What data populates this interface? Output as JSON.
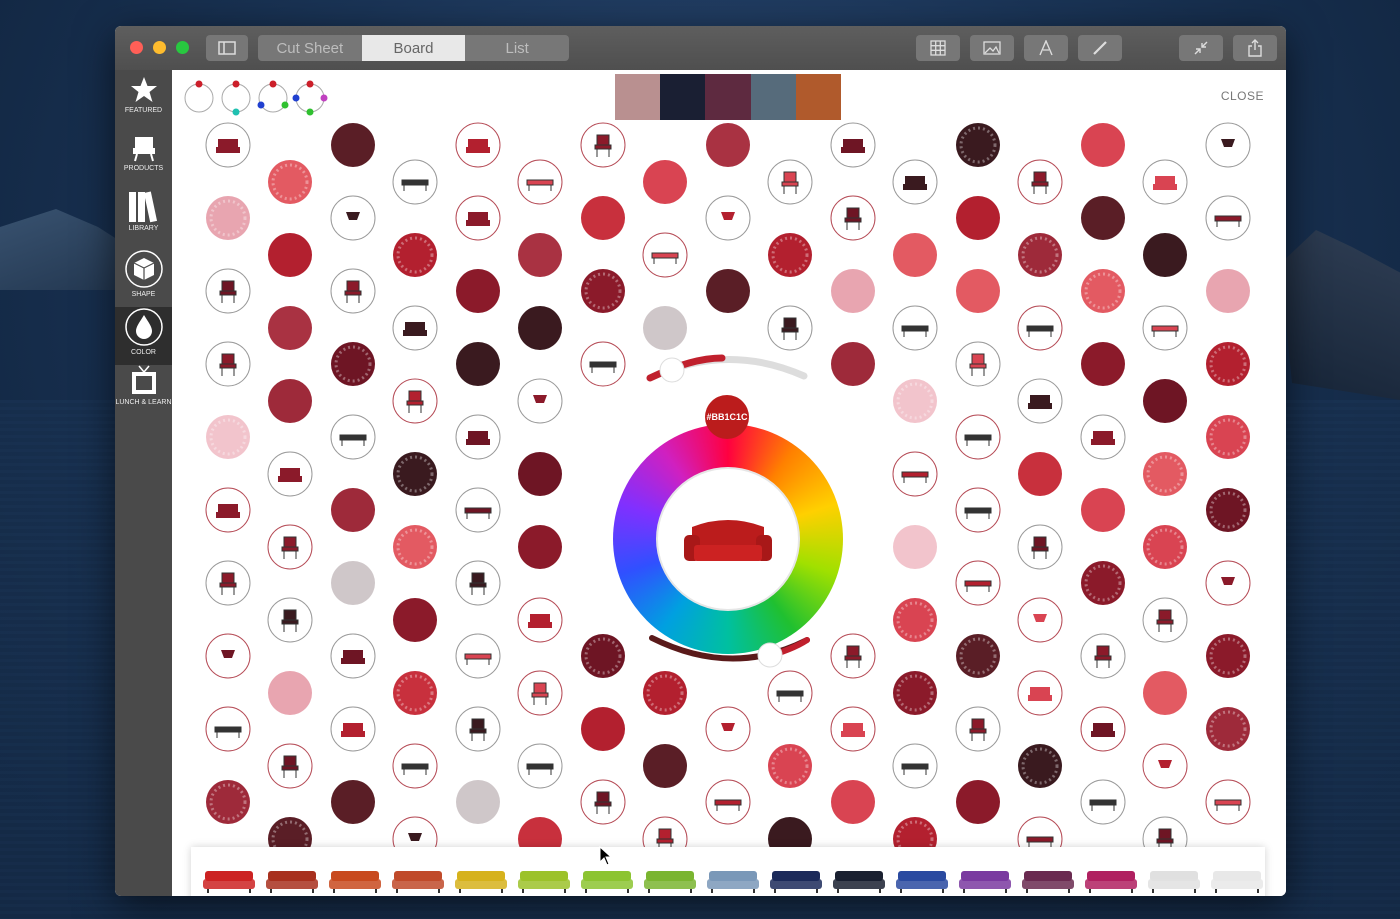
{
  "titlebar": {
    "tabs": [
      {
        "label": "Cut Sheet",
        "active": false
      },
      {
        "label": "Board",
        "active": true
      },
      {
        "label": "List",
        "active": false
      }
    ],
    "tools": [
      "grid-icon",
      "image-icon",
      "text-icon",
      "pen-icon",
      "collapse-icon",
      "share-icon"
    ]
  },
  "sidebar": {
    "items": [
      {
        "label": "FEATURED",
        "icon": "star-icon",
        "active": false
      },
      {
        "label": "PRODUCTS",
        "icon": "chair-icon",
        "active": false
      },
      {
        "label": "LIBRARY",
        "icon": "books-icon",
        "active": false
      },
      {
        "label": "SHAPE",
        "icon": "cube-icon",
        "active": false
      },
      {
        "label": "COLOR",
        "icon": "droplet-icon",
        "active": true
      },
      {
        "label": "LUNCH & LEARN",
        "icon": "tv-icon",
        "active": false
      }
    ]
  },
  "topbar": {
    "close_label": "CLOSE",
    "harmony_modes": [
      "single",
      "complementary",
      "triad",
      "tetrad"
    ],
    "palette": [
      "#B99090",
      "#1A1F33",
      "#5E2A40",
      "#566B7B",
      "#B05A2C"
    ]
  },
  "picker": {
    "hex": "#BB1C1C",
    "color": "#BB1C1C"
  },
  "colors": {
    "reds": [
      "#8B1A2A",
      "#B3202F",
      "#6E1524",
      "#D94452",
      "#3A1A1F",
      "#C8303D",
      "#E8A5B0",
      "#9E2A3A",
      "#F2C4CC",
      "#5A1E26",
      "#E35A62",
      "#A93242",
      "#cfc7c9"
    ]
  },
  "strip": {
    "sofas": [
      "#cc2222",
      "#a8301e",
      "#c84a1e",
      "#c04a2a",
      "#d6b21c",
      "#9cc22a",
      "#8cc431",
      "#7ab530",
      "#7a98b8",
      "#1c2a5a",
      "#1a2030",
      "#2a4aa0",
      "#7a3aa0",
      "#6a2a50",
      "#b02060",
      "#e0e0e0",
      "#e8e8e8"
    ]
  }
}
